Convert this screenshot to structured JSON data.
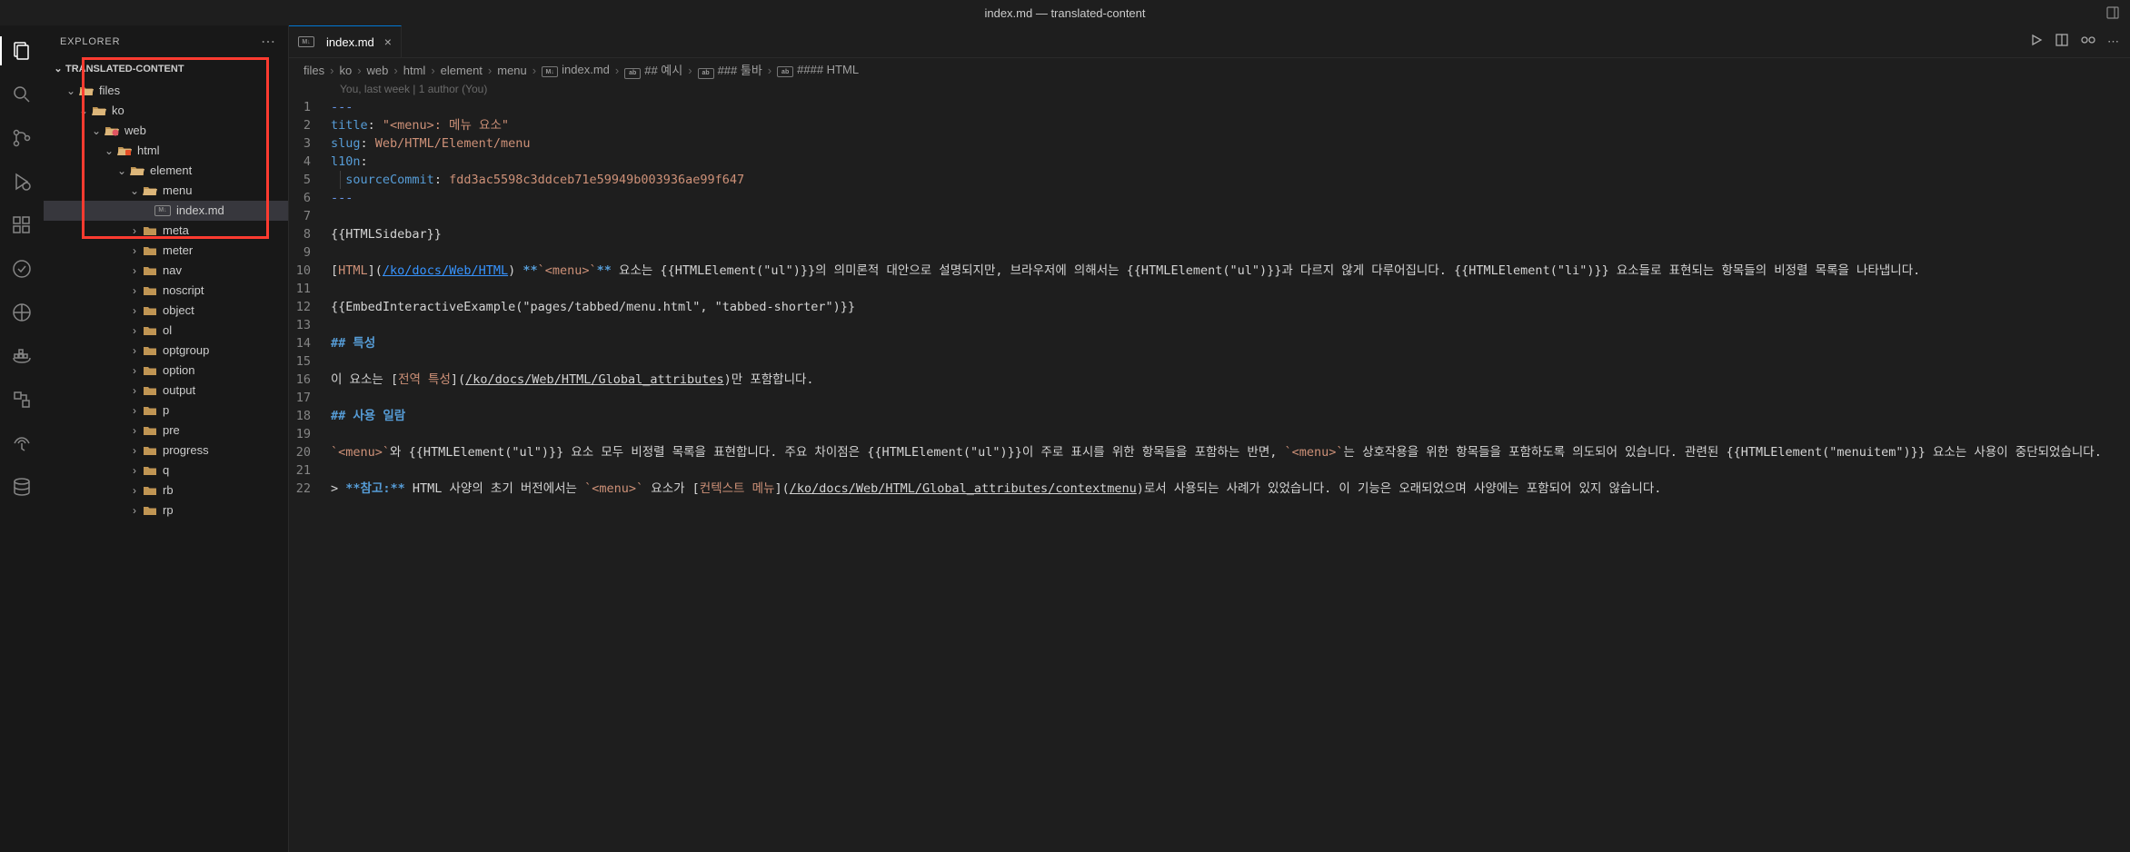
{
  "titlebar": {
    "title": "index.md — translated-content"
  },
  "sidebar": {
    "header": "EXPLORER",
    "section_title": "TRANSLATED-CONTENT"
  },
  "tree": {
    "files": "files",
    "ko": "ko",
    "web": "web",
    "html": "html",
    "element": "element",
    "menu": "menu",
    "index": "index.md",
    "meta": "meta",
    "meter": "meter",
    "nav": "nav",
    "noscript": "noscript",
    "object": "object",
    "ol": "ol",
    "optgroup": "optgroup",
    "option": "option",
    "output": "output",
    "p": "p",
    "pre": "pre",
    "progress": "progress",
    "q": "q",
    "rb": "rb",
    "rp": "rp"
  },
  "tab": {
    "label": "index.md"
  },
  "breadcrumbs": {
    "files": "files",
    "ko": "ko",
    "web": "web",
    "html": "html",
    "element": "element",
    "menu": "menu",
    "index": "index.md",
    "h2": "## 예시",
    "h3": "### 툴바",
    "h4": "#### HTML"
  },
  "blame": "You, last week | 1 author (You)",
  "code": {
    "l1": "---",
    "l2_key": "title",
    "l2_val": "\"<menu>: 메뉴 요소\"",
    "l3_key": "slug",
    "l3_val": "Web/HTML/Element/menu",
    "l4_key": "l10n",
    "l5_key": "sourceCommit",
    "l5_val": "fdd3ac5598c3ddceb71e59949b003936ae99f647",
    "l6": "---",
    "l8": "{{HTMLSidebar}}",
    "l10_a": "HTML",
    "l10_url": "/ko/docs/Web/HTML",
    "l10_b": "**`<menu>`**",
    "l10_c": " 요소는 {{HTMLElement(\"ul\")}}의 의미론적 대안으로 설명되지만, 브라우저에 의해서는 {{HTMLElement(\"ul\")}}과 다르지 않게 다루어집니다. {{HTMLElement(\"li\")}} 요소들로 표현되는 항목들의 비정렬 목록을 나타냅니다.",
    "l12": "{{EmbedInteractiveExample(\"pages/tabbed/menu.html\", \"tabbed-shorter\")}}",
    "l14": "## 특성",
    "l16_a": "이 요소는 ",
    "l16_link": "전역 특성",
    "l16_url": "/ko/docs/Web/HTML/Global_attributes",
    "l16_b": "만 포함합니다.",
    "l18": "## 사용 일람",
    "l20_a": "`<menu>`",
    "l20_b": "와 {{HTMLElement(\"ul\")}} 요소 모두 비정렬 목록을 표현합니다. 주요 차이점은 {{HTMLElement(\"ul\")}}이 주로 표시를 위한 항목들을 포함하는 반면, ",
    "l20_c": "`<menu>`",
    "l20_d": "는 상호작용을 위한 항목들을 포함하도록 의도되어 있습니다. 관련된 {{HTMLElement(\"menuitem\")}} 요소는 사용이 중단되었습니다.",
    "l22_a": "> ",
    "l22_b": "**참고:**",
    "l22_c": " HTML 사양의 초기 버전에서는 ",
    "l22_d": "`<menu>`",
    "l22_e": " 요소가 ",
    "l22_link": "컨텍스트 메뉴",
    "l22_url": "/ko/docs/Web/HTML/Global_attributes/contextmenu",
    "l22_f": "로서 사용되는 사례가 있었습니다. 이 기능은 오래되었으며 사양에는 포함되어 있지 않습니다."
  }
}
